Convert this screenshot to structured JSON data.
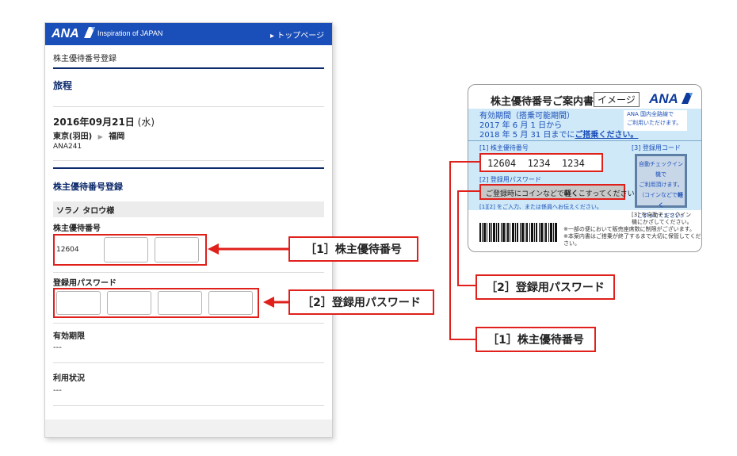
{
  "phone": {
    "header": {
      "logo": "ANA",
      "tagline": "Inspiration of JAPAN",
      "top_link": "▸ トップページ"
    },
    "breadcrumb": "株主優待番号登録",
    "itinerary": {
      "title": "旅程",
      "date": "2016年09月21日",
      "weekday": "(水)",
      "route_from": "東京(羽田)",
      "route_to": "福岡",
      "flight": "ANA241"
    },
    "registration": {
      "title": "株主優待番号登録",
      "passenger_name": "ソラノ タロウ様",
      "number_label": "株主優待番号",
      "number_prefix": "12604",
      "password_label": "登録用パスワード",
      "expiry_label": "有効期限",
      "expiry_value": "---",
      "usage_label": "利用状況",
      "usage_value": "---"
    }
  },
  "callouts": {
    "number": "［1］株主優待番号",
    "password": "［2］登録用パスワード"
  },
  "card": {
    "title": "株主優待番号ご案内書",
    "image_tag": "イメージ",
    "logo": "ANA",
    "validity_line1": "有効期間（搭乗可能期間）",
    "validity_line2": "2017 年 6 月 1 日から",
    "validity_line3a": "2018 年 5 月 31 日までに",
    "validity_line3b": "ご搭乗ください。",
    "ana_note_line1": "ANA 国内全路線で",
    "ana_note_line2": "ご利用いただけます。",
    "number_label": "[1] 株主優待番号",
    "number_value": "12604  1234  1234",
    "password_label": "[2] 登録用パスワード",
    "password_value_a": "ご登録時にコインなどで",
    "password_value_b": "軽く",
    "password_value_c": "こすってください",
    "code_label": "[3] 登録用コード",
    "checkin_line1": "自動チェックイン機で",
    "checkin_line2": "ご利用頂けます。",
    "checkin_line3a": "（コインなどで",
    "checkin_line3b": "軽く",
    "checkin_line4": "こすってください）",
    "input_note": "[1][2] をご入力、または係員へお伝えください。",
    "checkin_note_line1": "[3] を自動チェックイン",
    "checkin_note_line2": "機にかざしてください。",
    "footer_note1": "※一部の便において販売座席数に制限がございます。",
    "footer_note2": "※本案内書はご搭乗が終了するまで大切に保管してください。"
  },
  "colors": {
    "header_blue": "#1a4eb8",
    "navy": "#0d2a6b",
    "callout_red": "#e0201b",
    "card_blue": "#cfe9f8"
  }
}
